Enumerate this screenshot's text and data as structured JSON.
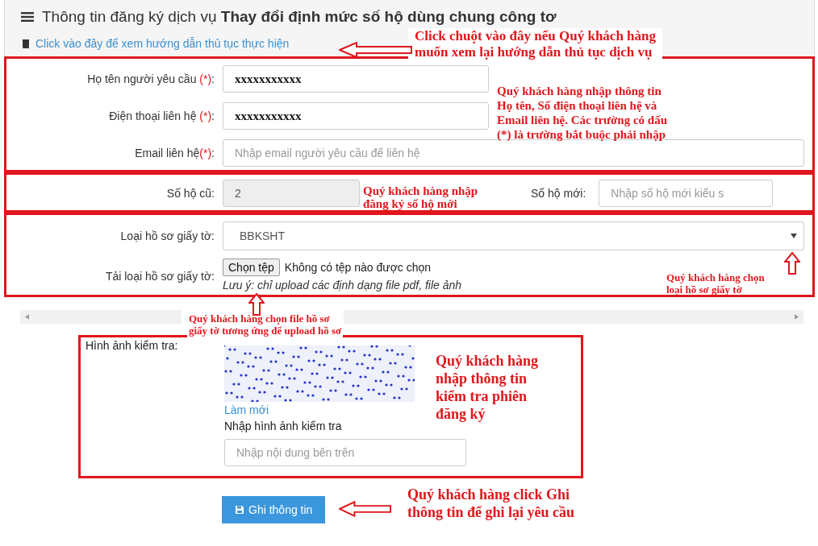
{
  "header": {
    "title": "Thông tin đăng ký dịch vụ **Thay đổi định mức số hộ dùng chung công tơ**",
    "guide_link": "Click vào đây để xem hướng dẫn thủ tục thực hiện"
  },
  "contact_fields": [
    {
      "label": "Họ tên người yêu cầu ",
      "required_mark": "(*)",
      "label_end": ":",
      "value": "xxxxxxxxxxx"
    },
    {
      "label": "Điện thoại liên hệ ",
      "required_mark": "(*)",
      "label_end": ":",
      "value": "xxxxxxxxxxx"
    },
    {
      "label": "Email liên hệ",
      "required_mark": "(*)",
      "label_end": ":",
      "placeholder": "Nhập email người yêu cầu để liên hệ"
    }
  ],
  "households": {
    "old_label": "Số hộ cũ:",
    "old_value": "2",
    "old_disabled": true,
    "new_label": "Số hộ mới:",
    "new_placeholder": "Nhập số hộ mới kiểu s"
  },
  "documents": {
    "type_label": "Loại hồ sơ giấy tờ:",
    "type_value": "BBKSHT",
    "upload_label": "Tải loại hồ sơ giấy tờ:",
    "choose_button": "Chọn tệp",
    "no_file": "Không có tệp nào được chọn",
    "note": "Lưu ý: chỉ upload các định dạng file pdf, file ảnh"
  },
  "captcha": {
    "label": "Hình ảnh kiểm tra:",
    "refresh_link": "Làm mới",
    "input_label": "Nhập hình ảnh kiểm tra",
    "placeholder": "Nhập nội dung bên trên"
  },
  "submit_button": "Ghi thông tin",
  "annotations": [
    {
      "kind": "guide",
      "lines": [
        "Click chuột vào đây nếu Quý khách hàng",
        "muốn xem lại hướng dẫn thủ tục dịch vụ"
      ]
    },
    {
      "kind": "contact",
      "lines": [
        "Quý khách hàng nhập thông tin",
        "Họ tên, Số điện thoại liên hệ và",
        "Email liên hệ. Các trường có dấu",
        "(*) là trường bắt buộc phải nhập"
      ]
    },
    {
      "kind": "households",
      "lines": [
        "Quý khách hàng nhập",
        "đăng ký số hộ mới"
      ]
    },
    {
      "kind": "doctype",
      "lines": [
        "Quý khách hàng chọn",
        "loại hồ sơ giấy tờ"
      ]
    },
    {
      "kind": "upload",
      "lines": [
        "Quý khách hàng chọn file hồ sơ",
        "giấy tờ tương ứng để upload hồ sơ"
      ]
    },
    {
      "kind": "captcha",
      "lines": [
        "Quý khách hàng",
        "nhập thông tin",
        "kiểm tra phiên",
        "đăng ký"
      ]
    },
    {
      "kind": "submit",
      "lines": [
        "Quý khách hàng click Ghi",
        "thông tin để ghi lại yêu cầu"
      ]
    }
  ]
}
